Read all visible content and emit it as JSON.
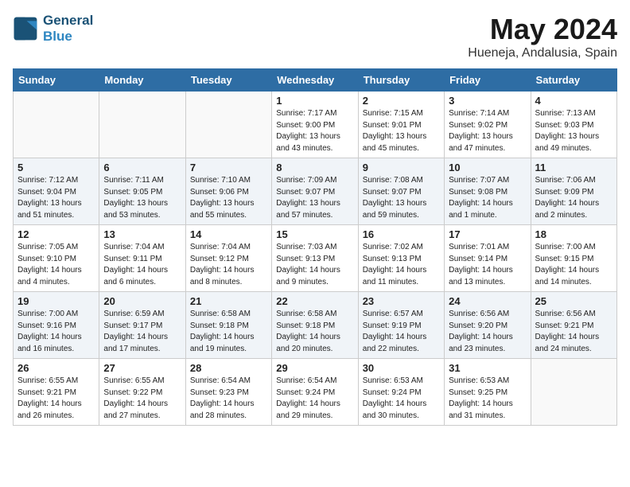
{
  "header": {
    "logo_general": "General",
    "logo_blue": "Blue",
    "month_title": "May 2024",
    "location": "Hueneja, Andalusia, Spain"
  },
  "days_of_week": [
    "Sunday",
    "Monday",
    "Tuesday",
    "Wednesday",
    "Thursday",
    "Friday",
    "Saturday"
  ],
  "weeks": [
    [
      {
        "day": "",
        "sunrise": "",
        "sunset": "",
        "daylight": ""
      },
      {
        "day": "",
        "sunrise": "",
        "sunset": "",
        "daylight": ""
      },
      {
        "day": "",
        "sunrise": "",
        "sunset": "",
        "daylight": ""
      },
      {
        "day": "1",
        "sunrise": "Sunrise: 7:17 AM",
        "sunset": "Sunset: 9:00 PM",
        "daylight": "Daylight: 13 hours and 43 minutes."
      },
      {
        "day": "2",
        "sunrise": "Sunrise: 7:15 AM",
        "sunset": "Sunset: 9:01 PM",
        "daylight": "Daylight: 13 hours and 45 minutes."
      },
      {
        "day": "3",
        "sunrise": "Sunrise: 7:14 AM",
        "sunset": "Sunset: 9:02 PM",
        "daylight": "Daylight: 13 hours and 47 minutes."
      },
      {
        "day": "4",
        "sunrise": "Sunrise: 7:13 AM",
        "sunset": "Sunset: 9:03 PM",
        "daylight": "Daylight: 13 hours and 49 minutes."
      }
    ],
    [
      {
        "day": "5",
        "sunrise": "Sunrise: 7:12 AM",
        "sunset": "Sunset: 9:04 PM",
        "daylight": "Daylight: 13 hours and 51 minutes."
      },
      {
        "day": "6",
        "sunrise": "Sunrise: 7:11 AM",
        "sunset": "Sunset: 9:05 PM",
        "daylight": "Daylight: 13 hours and 53 minutes."
      },
      {
        "day": "7",
        "sunrise": "Sunrise: 7:10 AM",
        "sunset": "Sunset: 9:06 PM",
        "daylight": "Daylight: 13 hours and 55 minutes."
      },
      {
        "day": "8",
        "sunrise": "Sunrise: 7:09 AM",
        "sunset": "Sunset: 9:07 PM",
        "daylight": "Daylight: 13 hours and 57 minutes."
      },
      {
        "day": "9",
        "sunrise": "Sunrise: 7:08 AM",
        "sunset": "Sunset: 9:07 PM",
        "daylight": "Daylight: 13 hours and 59 minutes."
      },
      {
        "day": "10",
        "sunrise": "Sunrise: 7:07 AM",
        "sunset": "Sunset: 9:08 PM",
        "daylight": "Daylight: 14 hours and 1 minute."
      },
      {
        "day": "11",
        "sunrise": "Sunrise: 7:06 AM",
        "sunset": "Sunset: 9:09 PM",
        "daylight": "Daylight: 14 hours and 2 minutes."
      }
    ],
    [
      {
        "day": "12",
        "sunrise": "Sunrise: 7:05 AM",
        "sunset": "Sunset: 9:10 PM",
        "daylight": "Daylight: 14 hours and 4 minutes."
      },
      {
        "day": "13",
        "sunrise": "Sunrise: 7:04 AM",
        "sunset": "Sunset: 9:11 PM",
        "daylight": "Daylight: 14 hours and 6 minutes."
      },
      {
        "day": "14",
        "sunrise": "Sunrise: 7:04 AM",
        "sunset": "Sunset: 9:12 PM",
        "daylight": "Daylight: 14 hours and 8 minutes."
      },
      {
        "day": "15",
        "sunrise": "Sunrise: 7:03 AM",
        "sunset": "Sunset: 9:13 PM",
        "daylight": "Daylight: 14 hours and 9 minutes."
      },
      {
        "day": "16",
        "sunrise": "Sunrise: 7:02 AM",
        "sunset": "Sunset: 9:13 PM",
        "daylight": "Daylight: 14 hours and 11 minutes."
      },
      {
        "day": "17",
        "sunrise": "Sunrise: 7:01 AM",
        "sunset": "Sunset: 9:14 PM",
        "daylight": "Daylight: 14 hours and 13 minutes."
      },
      {
        "day": "18",
        "sunrise": "Sunrise: 7:00 AM",
        "sunset": "Sunset: 9:15 PM",
        "daylight": "Daylight: 14 hours and 14 minutes."
      }
    ],
    [
      {
        "day": "19",
        "sunrise": "Sunrise: 7:00 AM",
        "sunset": "Sunset: 9:16 PM",
        "daylight": "Daylight: 14 hours and 16 minutes."
      },
      {
        "day": "20",
        "sunrise": "Sunrise: 6:59 AM",
        "sunset": "Sunset: 9:17 PM",
        "daylight": "Daylight: 14 hours and 17 minutes."
      },
      {
        "day": "21",
        "sunrise": "Sunrise: 6:58 AM",
        "sunset": "Sunset: 9:18 PM",
        "daylight": "Daylight: 14 hours and 19 minutes."
      },
      {
        "day": "22",
        "sunrise": "Sunrise: 6:58 AM",
        "sunset": "Sunset: 9:18 PM",
        "daylight": "Daylight: 14 hours and 20 minutes."
      },
      {
        "day": "23",
        "sunrise": "Sunrise: 6:57 AM",
        "sunset": "Sunset: 9:19 PM",
        "daylight": "Daylight: 14 hours and 22 minutes."
      },
      {
        "day": "24",
        "sunrise": "Sunrise: 6:56 AM",
        "sunset": "Sunset: 9:20 PM",
        "daylight": "Daylight: 14 hours and 23 minutes."
      },
      {
        "day": "25",
        "sunrise": "Sunrise: 6:56 AM",
        "sunset": "Sunset: 9:21 PM",
        "daylight": "Daylight: 14 hours and 24 minutes."
      }
    ],
    [
      {
        "day": "26",
        "sunrise": "Sunrise: 6:55 AM",
        "sunset": "Sunset: 9:21 PM",
        "daylight": "Daylight: 14 hours and 26 minutes."
      },
      {
        "day": "27",
        "sunrise": "Sunrise: 6:55 AM",
        "sunset": "Sunset: 9:22 PM",
        "daylight": "Daylight: 14 hours and 27 minutes."
      },
      {
        "day": "28",
        "sunrise": "Sunrise: 6:54 AM",
        "sunset": "Sunset: 9:23 PM",
        "daylight": "Daylight: 14 hours and 28 minutes."
      },
      {
        "day": "29",
        "sunrise": "Sunrise: 6:54 AM",
        "sunset": "Sunset: 9:24 PM",
        "daylight": "Daylight: 14 hours and 29 minutes."
      },
      {
        "day": "30",
        "sunrise": "Sunrise: 6:53 AM",
        "sunset": "Sunset: 9:24 PM",
        "daylight": "Daylight: 14 hours and 30 minutes."
      },
      {
        "day": "31",
        "sunrise": "Sunrise: 6:53 AM",
        "sunset": "Sunset: 9:25 PM",
        "daylight": "Daylight: 14 hours and 31 minutes."
      },
      {
        "day": "",
        "sunrise": "",
        "sunset": "",
        "daylight": ""
      }
    ]
  ]
}
